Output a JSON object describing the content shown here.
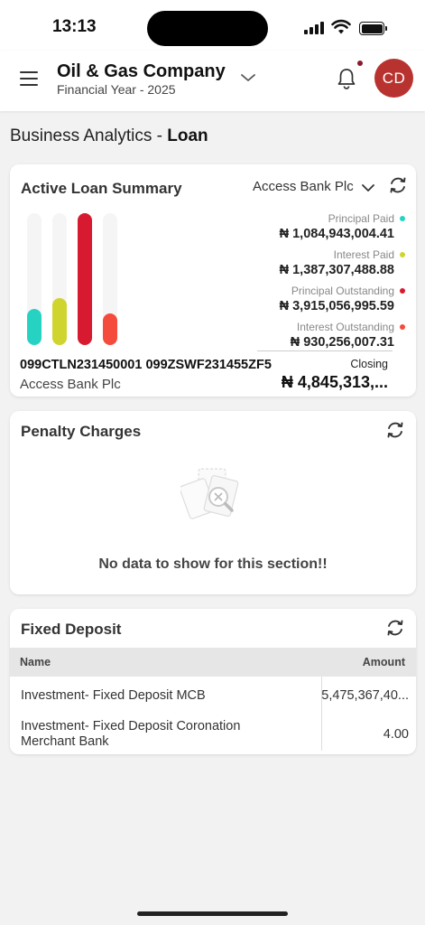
{
  "status_bar": {
    "time": "13:13"
  },
  "header": {
    "company": "Oil & Gas Company",
    "financial_year": "Financial Year - 2025",
    "avatar_initials": "CD",
    "avatar_color": "#b8332f",
    "notification_dot_color": "#8b1a2b"
  },
  "page": {
    "title_prefix": "Business Analytics - ",
    "title_bold": "Loan"
  },
  "loan_summary": {
    "title": "Active Loan Summary",
    "bank_selected": "Access Bank Plc",
    "legend": [
      {
        "label": "Principal Paid",
        "value": "₦ 1,084,943,004.41",
        "color": "#26d3c3"
      },
      {
        "label": "Interest Paid",
        "value": "₦ 1,387,307,488.88",
        "color": "#cfd42e"
      },
      {
        "label": "Principal Outstanding",
        "value": "₦ 3,915,056,995.59",
        "color": "#d71a30"
      },
      {
        "label": "Interest Outstanding",
        "value": "₦ 930,256,007.31",
        "color": "#f44b3d"
      }
    ],
    "bar_values": [
      1084943004.41,
      1387307488.88,
      3915056995.59,
      930256007.31
    ],
    "loan_numbers": "099CTLN231450001 099ZSWF231455ZF5",
    "bank_name": "Access Bank Plc",
    "closing_label": "Closing",
    "closing_value": "₦ 4,845,313,..."
  },
  "penalty": {
    "title": "Penalty Charges",
    "empty_message": "No data to show for this section!!"
  },
  "fixed_deposit": {
    "title": "Fixed Deposit",
    "columns": {
      "name": "Name",
      "amount": "Amount"
    },
    "rows": [
      {
        "name": "Investment- Fixed Deposit MCB",
        "amount": "5,475,367,40..."
      },
      {
        "name": "Investment- Fixed Deposit Coronation Merchant Bank",
        "amount": "4.00"
      }
    ]
  }
}
